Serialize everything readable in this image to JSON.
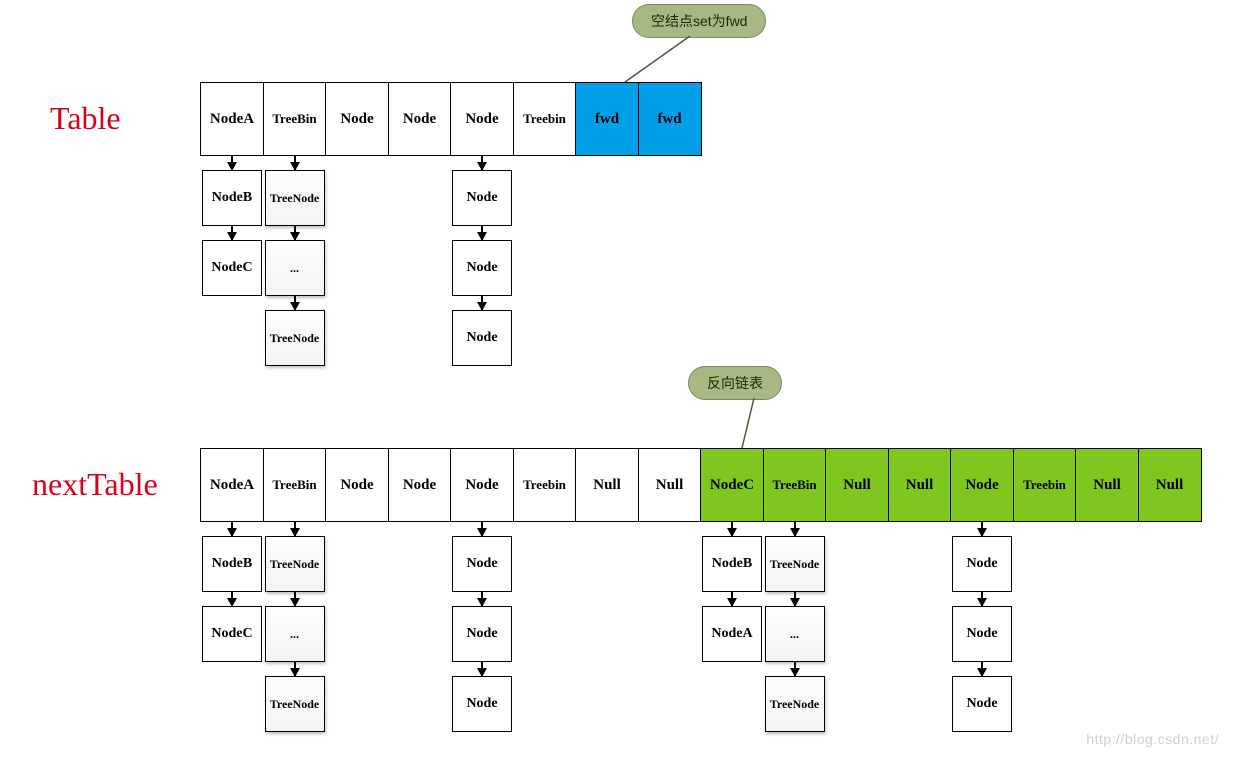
{
  "labels": {
    "table": "Table",
    "nextTable": "nextTable"
  },
  "callouts": {
    "top": "空结点set为fwd",
    "bottom": "反向链表"
  },
  "tableRow": [
    {
      "text": "NodeA",
      "cls": ""
    },
    {
      "text": "TreeBin",
      "cls": "small-text"
    },
    {
      "text": "Node",
      "cls": ""
    },
    {
      "text": "Node",
      "cls": ""
    },
    {
      "text": "Node",
      "cls": ""
    },
    {
      "text": "Treebin",
      "cls": "small-text"
    },
    {
      "text": "fwd",
      "cls": "blue"
    },
    {
      "text": "fwd",
      "cls": "blue"
    }
  ],
  "nextRow": [
    {
      "text": "NodeA",
      "cls": ""
    },
    {
      "text": "TreeBin",
      "cls": "small-text"
    },
    {
      "text": "Node",
      "cls": ""
    },
    {
      "text": "Node",
      "cls": ""
    },
    {
      "text": "Node",
      "cls": ""
    },
    {
      "text": "Treebin",
      "cls": "small-text"
    },
    {
      "text": "Null",
      "cls": ""
    },
    {
      "text": "Null",
      "cls": ""
    },
    {
      "text": "NodeC",
      "cls": "green"
    },
    {
      "text": "TreeBin",
      "cls": "green small-text"
    },
    {
      "text": "Null",
      "cls": "green"
    },
    {
      "text": "Null",
      "cls": "green"
    },
    {
      "text": "Node",
      "cls": "green"
    },
    {
      "text": "Treebin",
      "cls": "green small-text"
    },
    {
      "text": "Null",
      "cls": "green"
    },
    {
      "text": "Null",
      "cls": "green"
    }
  ],
  "chains": {
    "table": {
      "c0": [
        "NodeB",
        "NodeC"
      ],
      "c1_shadow": [
        "TreeNode",
        "...",
        "TreeNode"
      ],
      "c4": [
        "Node",
        "Node",
        "Node"
      ]
    },
    "next": {
      "c0": [
        "NodeB",
        "NodeC"
      ],
      "c1_shadow": [
        "TreeNode",
        "...",
        "TreeNode"
      ],
      "c4": [
        "Node",
        "Node",
        "Node"
      ],
      "c8": [
        "NodeB",
        "NodeA"
      ],
      "c9_shadow": [
        "TreeNode",
        "...",
        "TreeNode"
      ],
      "c12": [
        "Node",
        "Node",
        "Node"
      ]
    }
  },
  "watermark": "http://blog.csdn.net/"
}
